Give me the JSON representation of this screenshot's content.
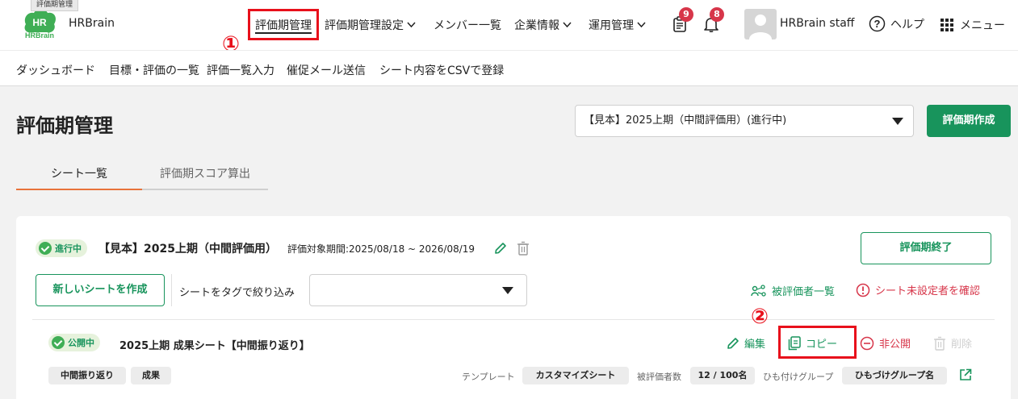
{
  "header": {
    "logo_text": "HR",
    "logo_subtext": "HRBrain",
    "logo_tooltip": "評価期管理",
    "brand_name": "HRBrain",
    "nav": [
      {
        "label": "評価期管理"
      },
      {
        "label": "評価期管理設定"
      },
      {
        "label": "メンバー一覧"
      },
      {
        "label": "企業情報"
      },
      {
        "label": "運用管理"
      }
    ],
    "notifications": {
      "tasks_count": "9",
      "bell_count": "8"
    },
    "user_name": "HRBrain staff",
    "help_label": "ヘルプ",
    "menu_label": "メニュー"
  },
  "annotations": {
    "step1": "①",
    "step2": "②"
  },
  "subnav": [
    "ダッシュボード",
    "目標・評価の一覧",
    "評価一覧入力",
    "催促メール送信",
    "シート内容をCSVで登録"
  ],
  "page": {
    "title": "評価期管理",
    "period_selected": "【見本】2025上期（中間評価用）(進行中)",
    "create_period_button": "評価期作成",
    "tabs": [
      "シート一覧",
      "評価期スコア算出"
    ]
  },
  "period_card": {
    "status": "進行中",
    "name": "【見本】2025上期（中間評価用）",
    "period_label": "評価対象期間:2025/08/18 ~ 2026/08/19",
    "end_button": "評価期終了",
    "new_sheet_button": "新しいシートを作成",
    "filter_label": "シートをタグで絞り込み",
    "filter_value": "",
    "evaluatees_link": "被評価者一覧",
    "unassigned_link": "シート未設定者を確認"
  },
  "sheet": {
    "status": "公開中",
    "name": "2025上期 成果シート【中間振り返り】",
    "edit_label": "編集",
    "copy_label": "コピー",
    "unpublish_label": "非公開",
    "delete_label": "削除",
    "tags": [
      "中間振り返り",
      "成果"
    ],
    "template_label": "テンプレート",
    "template_value": "カスタマイズシート",
    "evaluatee_count_label": "被評価者数",
    "evaluatee_count_value": "12 / 100名",
    "group_label": "ひも付けグループ",
    "group_value": "ひもづけグループ名"
  },
  "colors": {
    "brand_green": "#18945c",
    "highlight_red": "#e8101b",
    "badge_red": "#d7364a",
    "tab_active": "#e8733a"
  }
}
